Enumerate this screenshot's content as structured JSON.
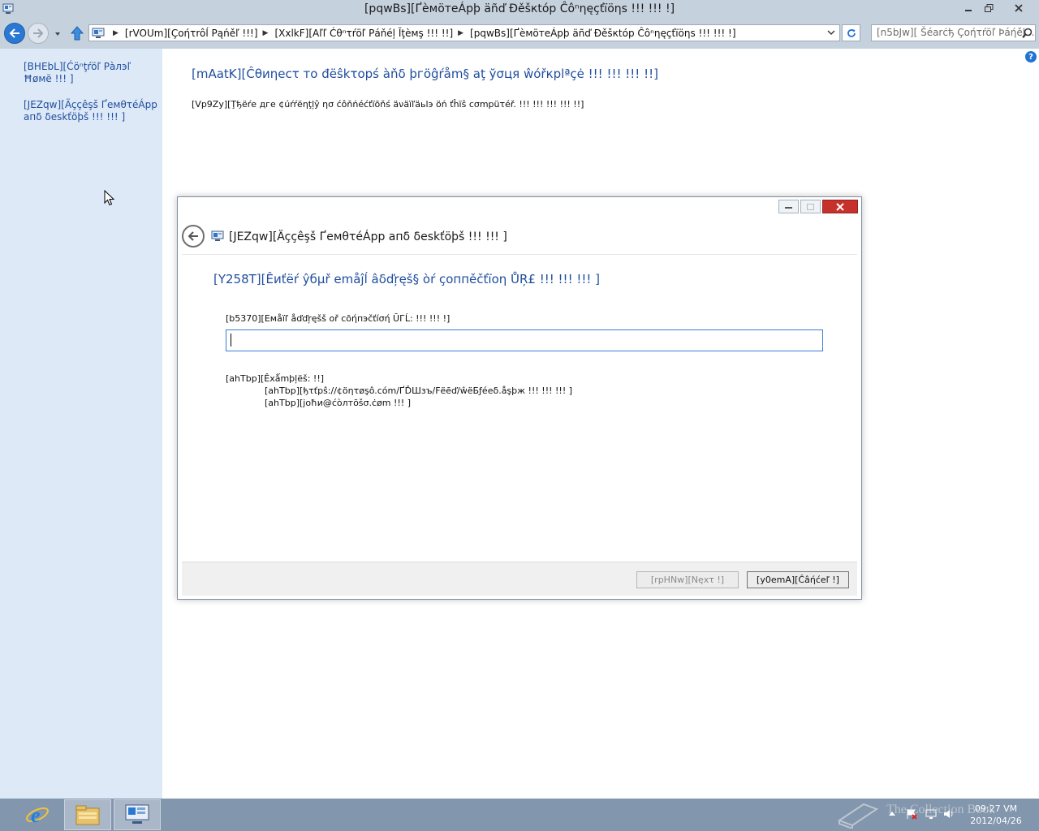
{
  "window": {
    "title": "[pqwBs][ҐèмöтеÁрþ äñď Đěšкtóp Ĉôⁿηęçťïöηs !!! !!! !]"
  },
  "nav": {
    "breadcrumbs": [
      "[rVOUm][Çoήτrôĺ Ρąńěľ !!!]",
      "[XxlkF][Aľľ Ćθⁿτŕöľ Ρáňéļ Ĭţèмş !!! !!]",
      "[pqwBs][ҐèмöтеÁрþ äñď Đěšкtóp Ĉôⁿηęçťïöηs !!! !!! !]"
    ],
    "search_placeholder": "[n5bJw][ Šéarċђ Çοήτŕöľ Þáήěļ ..."
  },
  "sidebar": {
    "items": [
      {
        "label": "[BHEbL][Ćöⁿţŕöľ Рàлэľ Ħøмë !!! ]"
      },
      {
        "label": "[JEZqw][Äççêşš ҐемθτéÁрр апδ δеskťöþš !!! !!! ]"
      }
    ]
  },
  "main": {
    "heading": "[mAatK][Ĉθиηесτ то đëŝkτорś àňδ þгöĝŕåm§ aţ ўσця ŵóřкplªçė !!! !!! !!! !!]",
    "text": "[Vp9Zy][Ţђёŕе дгe ¢úŕŕёηţļŷ ησ ćôňńéćťïõňś äνäïľäьlэ öń ťĥïŝ cσmpüτéř. !!! !!! !!! !!! !!]"
  },
  "dialog": {
    "title": "[JEZqw][Äççêşš ҐемθτéÁрр апδ δеskťöþš !!! !!! ]",
    "heading": "[Y258T][Êиťëŕ ŷбμř emåĵĺ âδďŗęš§ òŕ çοппěčťïοη ŮŖ£ !!! !!! !!! ]",
    "field_label": "[b5370][Eмåïľ åďďŗęšš oř cõήпэčťíσή ŪГĹ: !!! !!! !]",
    "field_value": "",
    "examples_label": "[ahTbp][Êxǻmþļёš: !!]",
    "examples": [
      "[ahTbp][ђτťрŝ://¢öητøşô.cóm/ҐĎШзъ/Fёēď/ŵёБƒéеδ.åşþж !!! !!! !!! ]",
      "[ahTbp][joħи@ćòлтõšσ.ċøm !!! ]"
    ],
    "next_label": "[rpHNw][Nęхτ !]",
    "cancel_label": "[y0emA][Ĉâήćеľ !]"
  },
  "taskbar": {
    "time": "09:27 VM",
    "date": "2012/04/26",
    "watermark": "The Collection Book"
  },
  "colors": {
    "accent": "#1f4d9e",
    "titlebar": "#c6d1de",
    "sidebar": "#dde9f7",
    "taskbar": "#8296ad",
    "close": "#c7312b"
  }
}
